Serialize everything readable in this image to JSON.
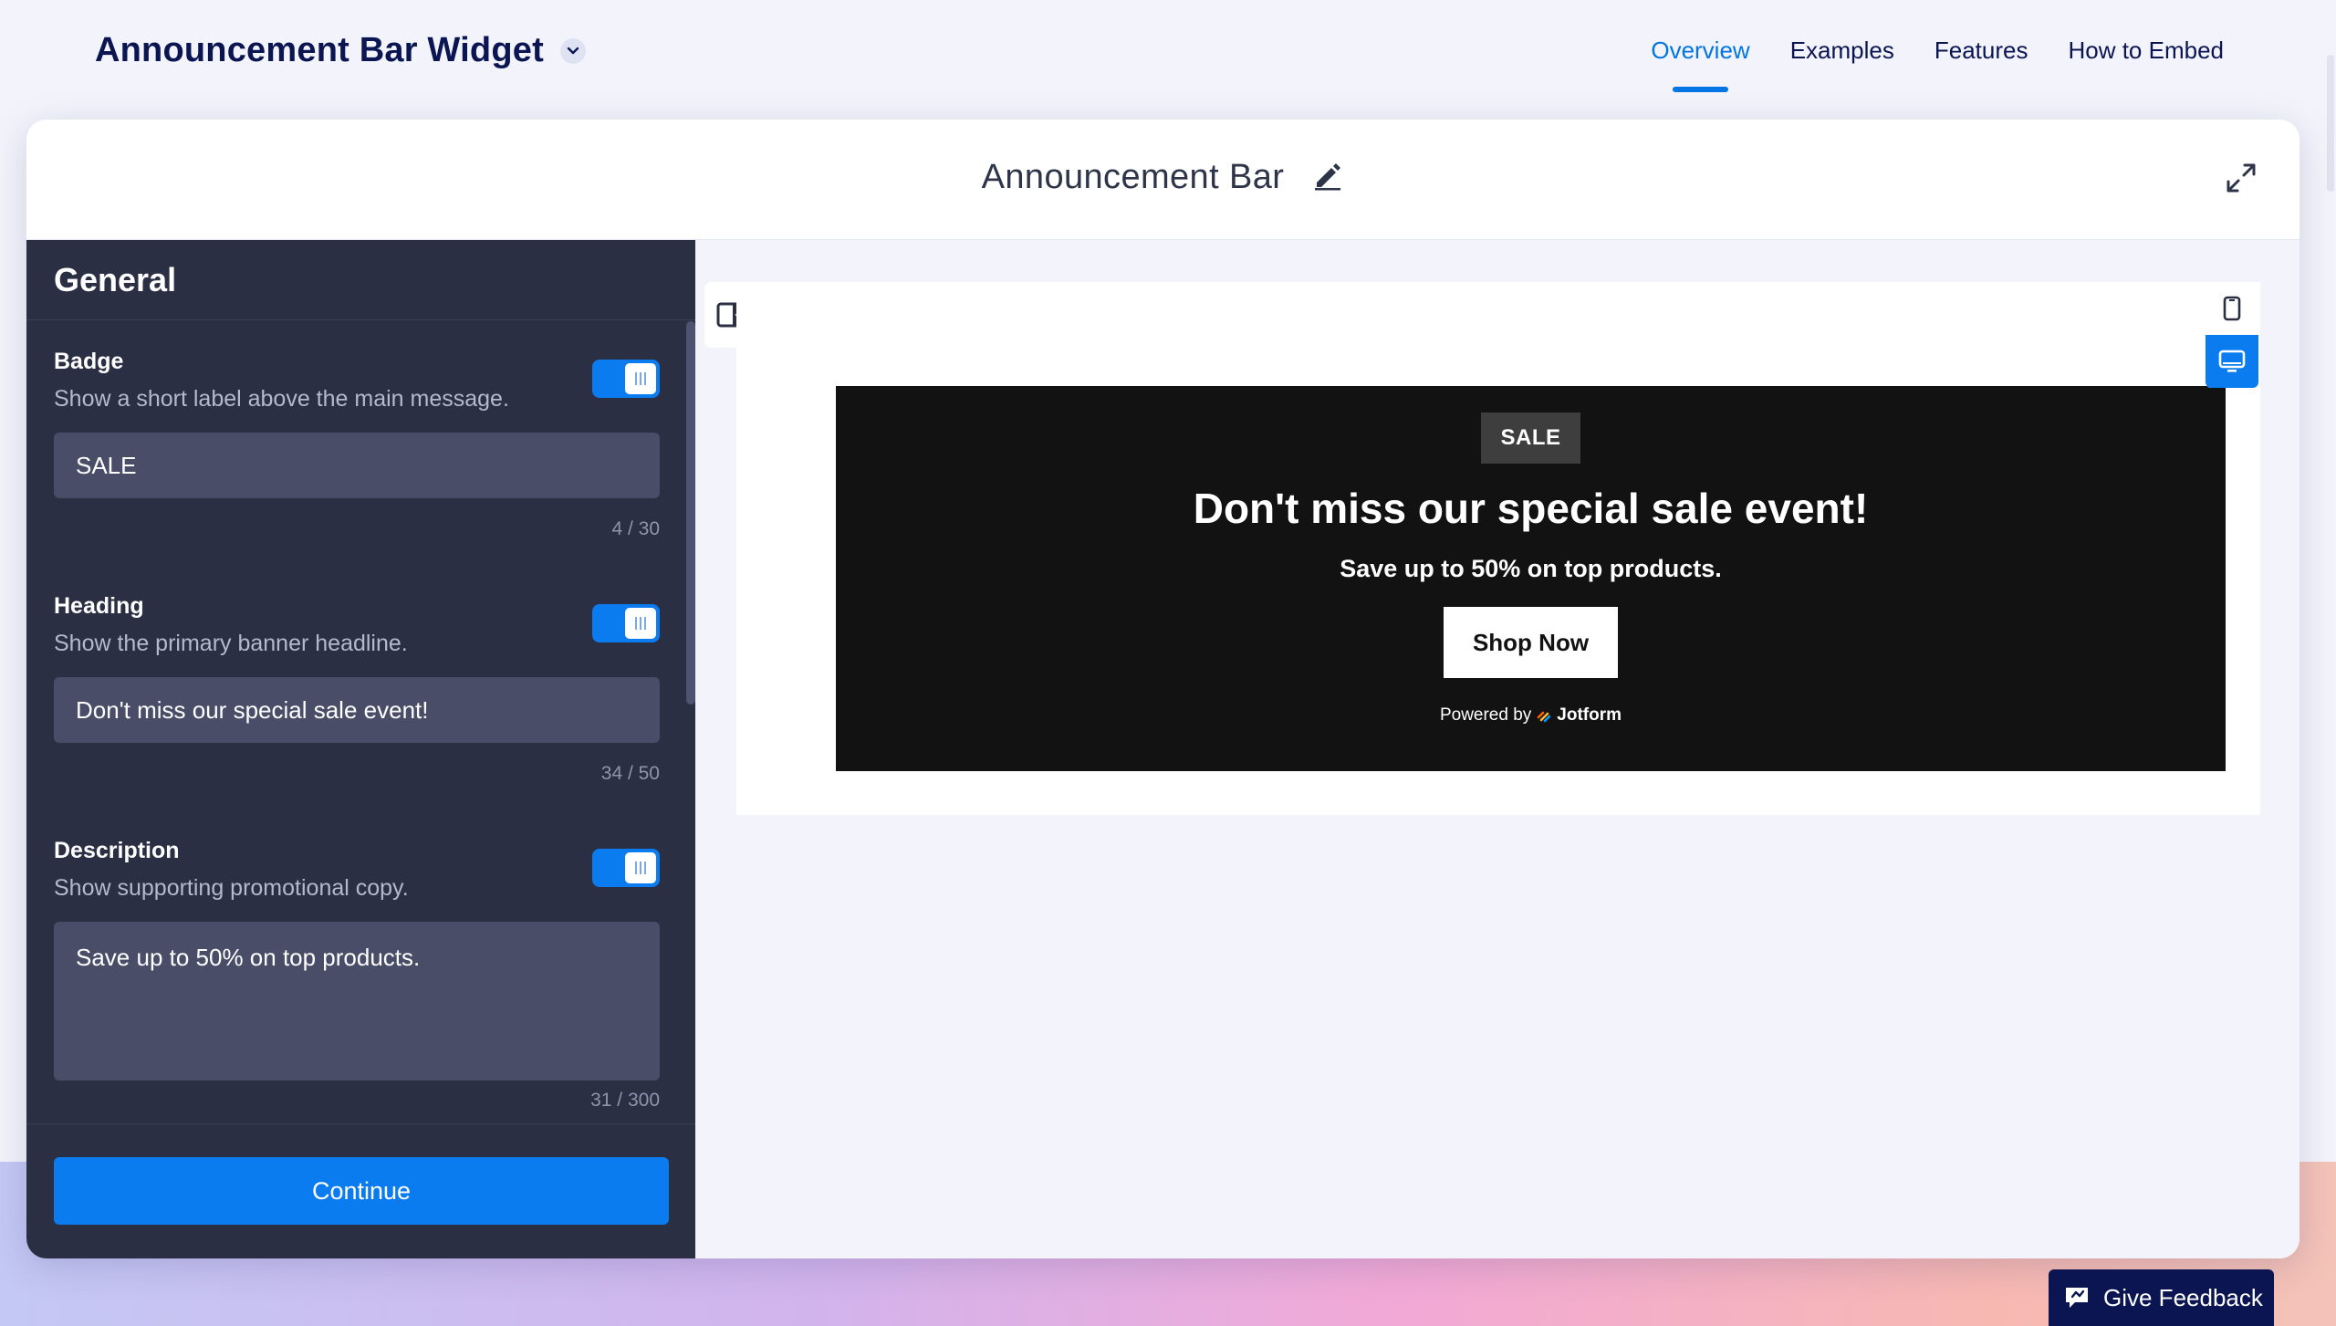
{
  "header": {
    "title": "Announcement Bar Widget",
    "nav": [
      {
        "label": "Overview",
        "active": true
      },
      {
        "label": "Examples",
        "active": false
      },
      {
        "label": "Features",
        "active": false
      },
      {
        "label": "How to Embed",
        "active": false
      }
    ]
  },
  "editor": {
    "title": "Announcement Bar"
  },
  "panel": {
    "title": "General",
    "fields": {
      "badge": {
        "label": "Badge",
        "description": "Show a short label above the main message.",
        "value": "SALE",
        "counter": "4 / 30",
        "enabled": true
      },
      "heading": {
        "label": "Heading",
        "description": "Show the primary banner headline.",
        "value": "Don't miss our special sale event!",
        "counter": "34 / 50",
        "enabled": true
      },
      "description": {
        "label": "Description",
        "description": "Show supporting promotional copy.",
        "value": "Save up to 50% on top products.",
        "counter": "31 / 300",
        "enabled": true
      }
    },
    "continue_label": "Continue"
  },
  "preview": {
    "badge": "SALE",
    "heading": "Don't miss our special sale event!",
    "description": "Save up to 50% on top products.",
    "button": "Shop Now",
    "powered_by": "Powered by",
    "powered_brand": "Jotform",
    "device": "desktop"
  },
  "feedback": {
    "label": "Give Feedback"
  },
  "colors": {
    "accent": "#0a7cf0",
    "panel_bg": "#2b2f44",
    "navy": "#0a1551",
    "banner_bg": "#121212"
  }
}
